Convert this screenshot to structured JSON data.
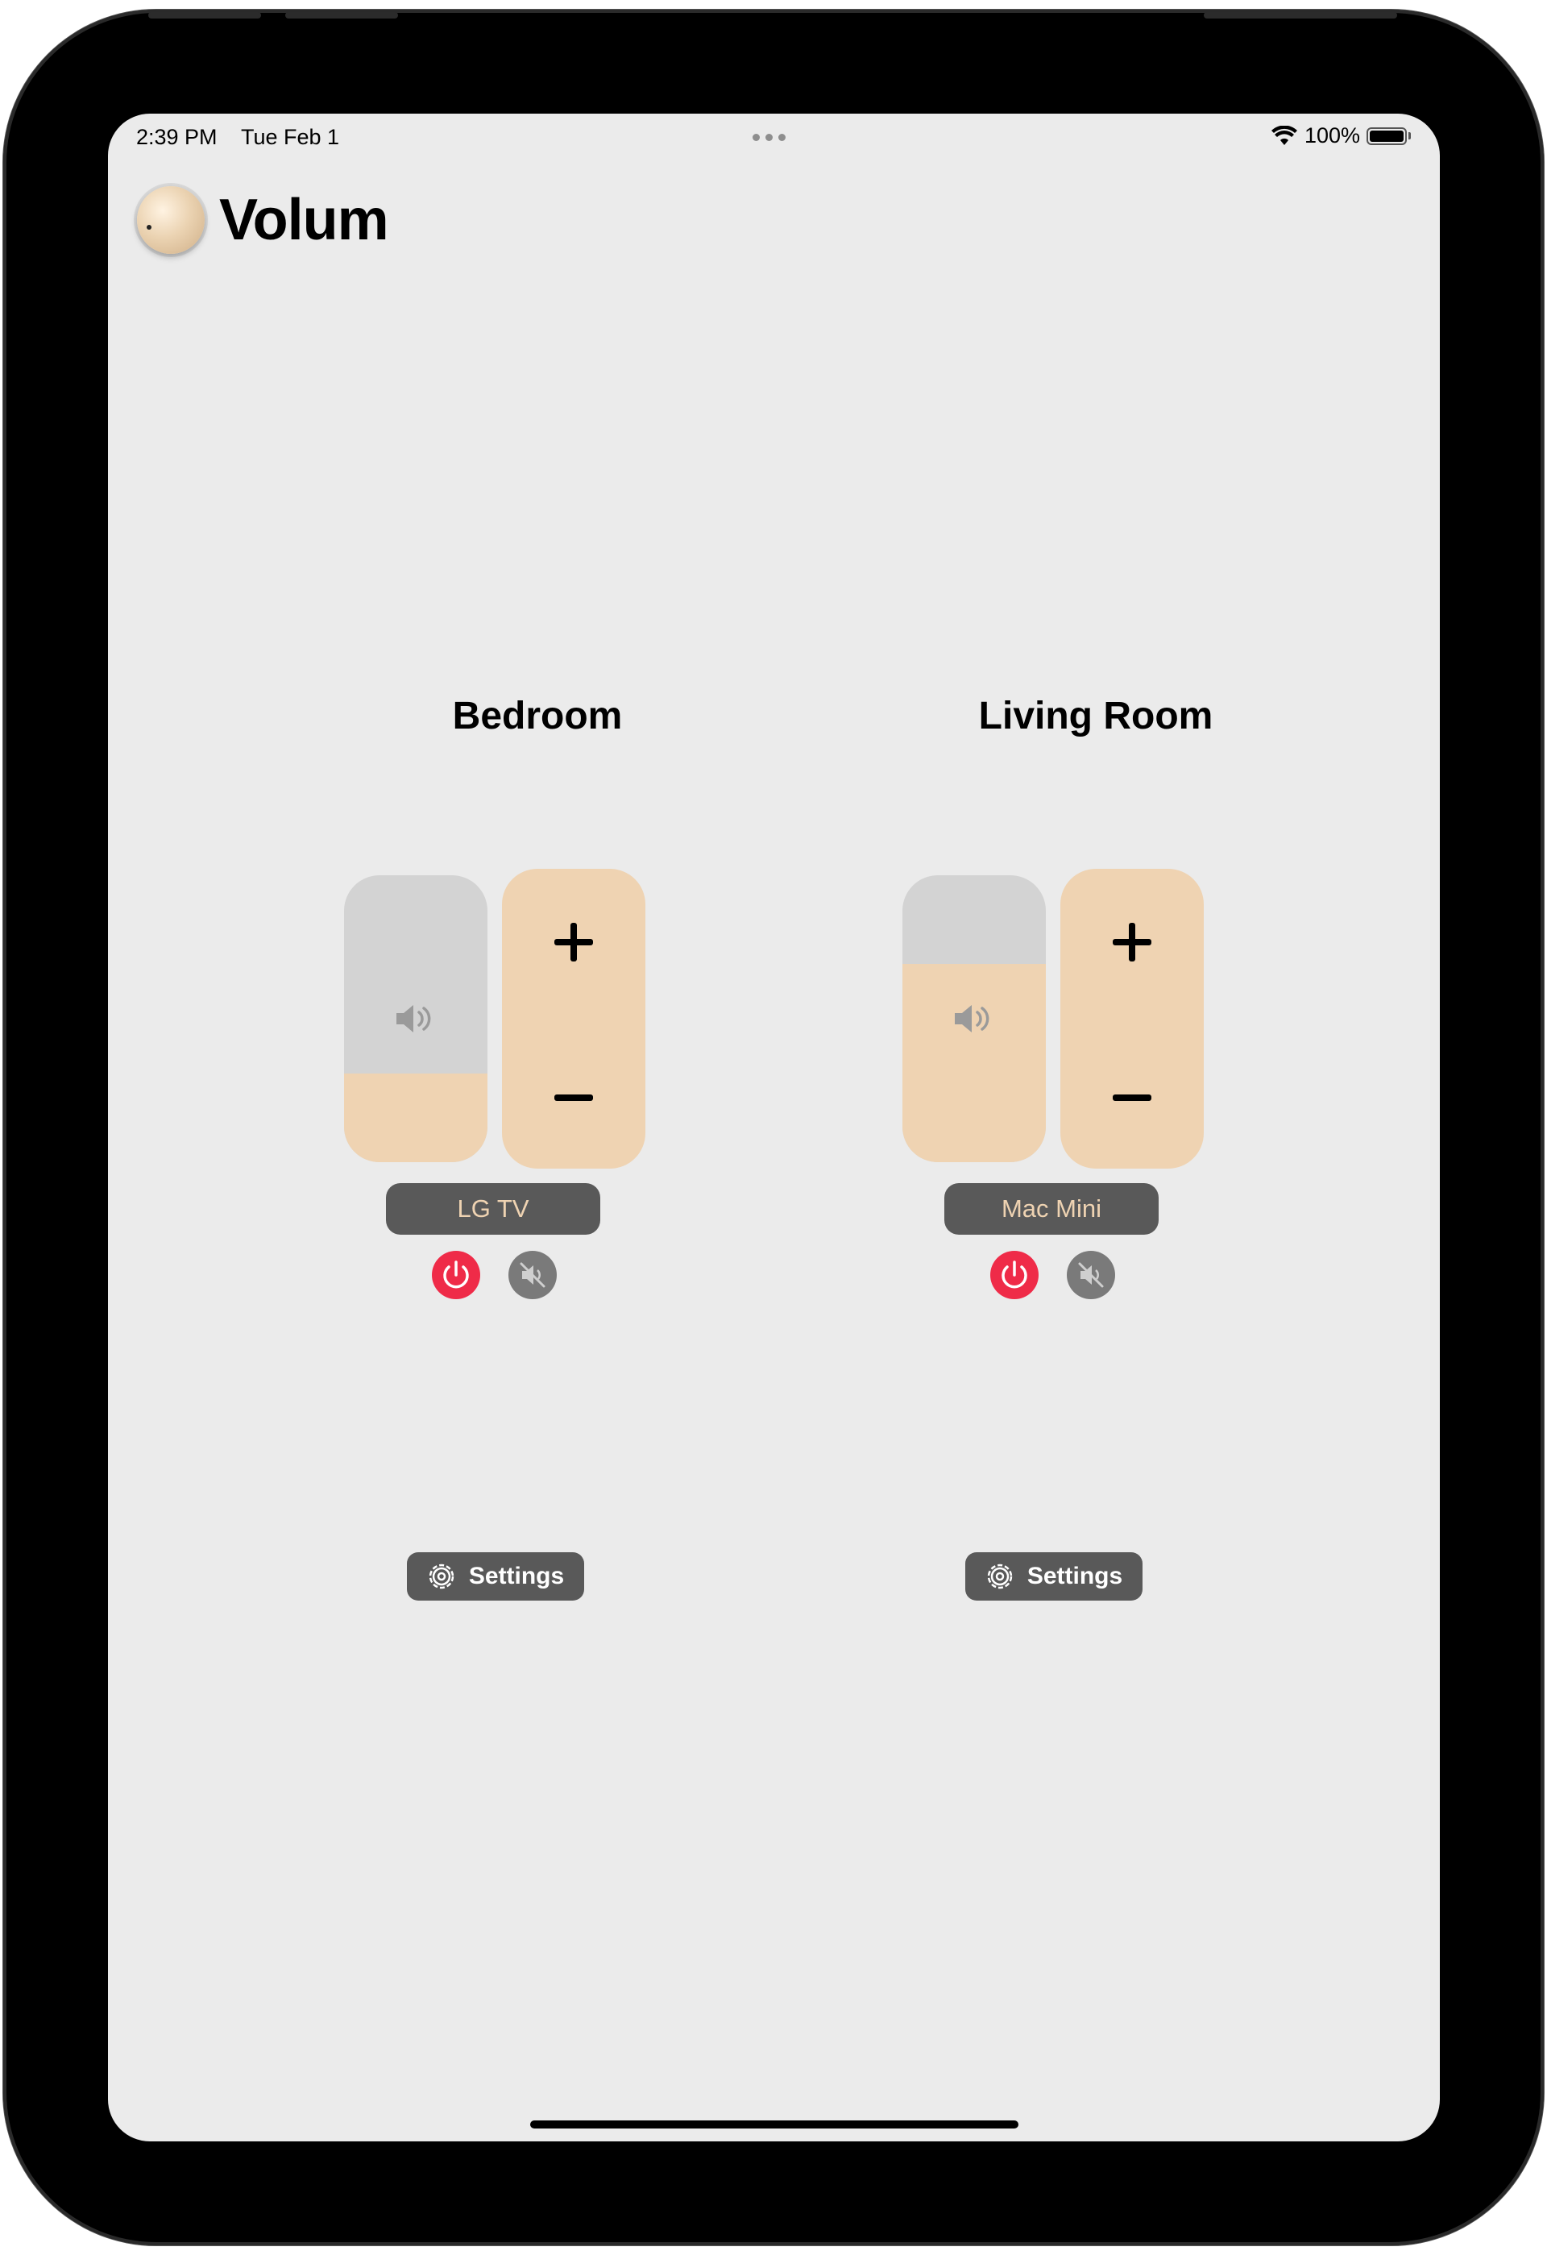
{
  "status_bar": {
    "time": "2:39 PM",
    "date": "Tue Feb 1",
    "battery_text": "100%",
    "battery_level": 1.0,
    "icons": [
      "wifi-icon",
      "battery-icon"
    ]
  },
  "app": {
    "title": "Volum",
    "logo_icon": "volume-knob-icon"
  },
  "colors": {
    "background": "#ebebeb",
    "accent": "#efd3b2",
    "slider_track": "#d3d3d3",
    "pill": "#595959",
    "power": "#ef2b48",
    "mute": "#7a7a7a"
  },
  "rooms": [
    {
      "name": "Bedroom",
      "device": "LG TV",
      "volume_level": 0.31,
      "plus_icon": "plus-icon",
      "minus_icon": "minus-icon",
      "settings_label": "Settings"
    },
    {
      "name": "Living Room",
      "device": "Mac Mini",
      "volume_level": 0.69,
      "plus_icon": "plus-icon",
      "minus_icon": "minus-icon",
      "settings_label": "Settings"
    }
  ]
}
